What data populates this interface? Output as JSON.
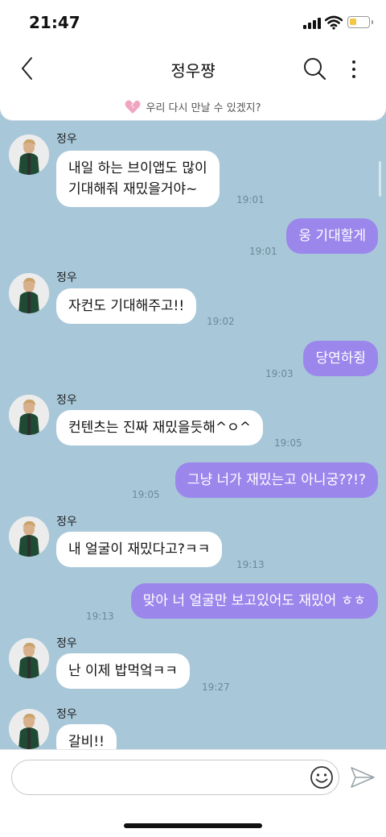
{
  "status_bar": {
    "time": "21:47",
    "battery_level": 0.35,
    "battery_color": "#f2c744"
  },
  "header": {
    "title": "정우쨩",
    "back_icon": "chevron-left-icon",
    "search_icon": "search-icon",
    "more_icon": "more-vertical-icon"
  },
  "notice": {
    "icon": "broken-heart-icon",
    "text": "우리 다시 만날 수 있겠지?",
    "icon_color": "#f0a5c0"
  },
  "colors": {
    "chat_background": "#a8c8da",
    "sent_bubble": "#9b87ec",
    "received_bubble": "#ffffff"
  },
  "messages": [
    {
      "type": "received",
      "sender": "정우",
      "text": "내일 하는 브이앱도 많이\n기대해줘 재밌을거야~",
      "time": "19:01"
    },
    {
      "type": "sent",
      "text": "웅 기대할게",
      "time": "19:01"
    },
    {
      "type": "received",
      "sender": "정우",
      "text": "자컨도 기대해주고!!",
      "time": "19:02"
    },
    {
      "type": "sent",
      "text": "당연하쥥",
      "time": "19:03"
    },
    {
      "type": "received",
      "sender": "정우",
      "text": "컨텐츠는 진짜 재밌을듯해^ㅇ^",
      "time": "19:05"
    },
    {
      "type": "sent",
      "text": "그냥 너가 재밌는고 아니궁??!?",
      "time": "19:05"
    },
    {
      "type": "received",
      "sender": "정우",
      "text": "내 얼굴이 재밌다고?ㅋㅋ",
      "time": "19:13"
    },
    {
      "type": "sent",
      "text": "맞아 너 얼굴만 보고있어도 재밌어 ㅎㅎ",
      "time": "19:13"
    },
    {
      "type": "received",
      "sender": "정우",
      "text": "난 이제 밥먹엌ㅋㅋ",
      "time": "19:27"
    },
    {
      "type": "received",
      "sender": "정우",
      "text": "갈비!!",
      "time": ""
    }
  ],
  "input": {
    "value": "",
    "placeholder": "",
    "emoji_icon": "smiley-icon",
    "send_icon": "send-icon"
  }
}
